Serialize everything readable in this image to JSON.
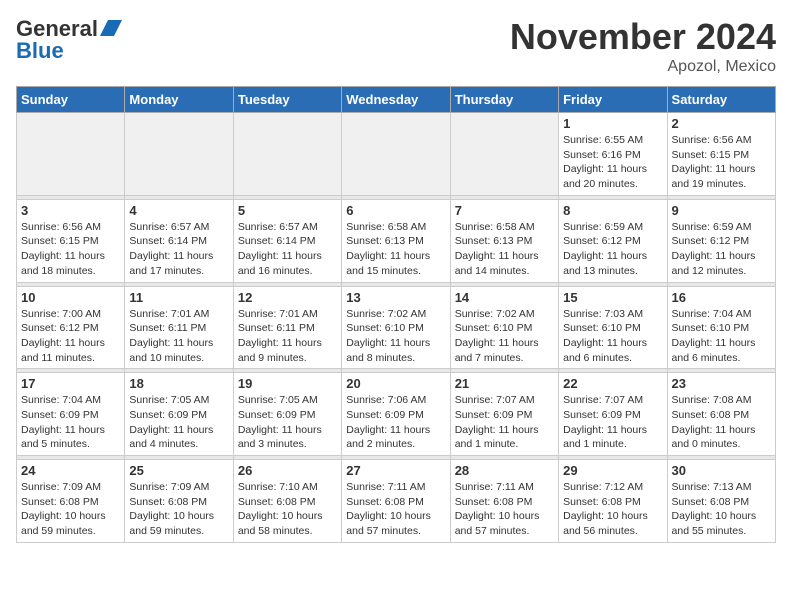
{
  "header": {
    "logo_general": "General",
    "logo_blue": "Blue",
    "month_title": "November 2024",
    "location": "Apozol, Mexico"
  },
  "weekdays": [
    "Sunday",
    "Monday",
    "Tuesday",
    "Wednesday",
    "Thursday",
    "Friday",
    "Saturday"
  ],
  "weeks": [
    [
      {
        "day": "",
        "info": ""
      },
      {
        "day": "",
        "info": ""
      },
      {
        "day": "",
        "info": ""
      },
      {
        "day": "",
        "info": ""
      },
      {
        "day": "",
        "info": ""
      },
      {
        "day": "1",
        "info": "Sunrise: 6:55 AM\nSunset: 6:16 PM\nDaylight: 11 hours and 20 minutes."
      },
      {
        "day": "2",
        "info": "Sunrise: 6:56 AM\nSunset: 6:15 PM\nDaylight: 11 hours and 19 minutes."
      }
    ],
    [
      {
        "day": "3",
        "info": "Sunrise: 6:56 AM\nSunset: 6:15 PM\nDaylight: 11 hours and 18 minutes."
      },
      {
        "day": "4",
        "info": "Sunrise: 6:57 AM\nSunset: 6:14 PM\nDaylight: 11 hours and 17 minutes."
      },
      {
        "day": "5",
        "info": "Sunrise: 6:57 AM\nSunset: 6:14 PM\nDaylight: 11 hours and 16 minutes."
      },
      {
        "day": "6",
        "info": "Sunrise: 6:58 AM\nSunset: 6:13 PM\nDaylight: 11 hours and 15 minutes."
      },
      {
        "day": "7",
        "info": "Sunrise: 6:58 AM\nSunset: 6:13 PM\nDaylight: 11 hours and 14 minutes."
      },
      {
        "day": "8",
        "info": "Sunrise: 6:59 AM\nSunset: 6:12 PM\nDaylight: 11 hours and 13 minutes."
      },
      {
        "day": "9",
        "info": "Sunrise: 6:59 AM\nSunset: 6:12 PM\nDaylight: 11 hours and 12 minutes."
      }
    ],
    [
      {
        "day": "10",
        "info": "Sunrise: 7:00 AM\nSunset: 6:12 PM\nDaylight: 11 hours and 11 minutes."
      },
      {
        "day": "11",
        "info": "Sunrise: 7:01 AM\nSunset: 6:11 PM\nDaylight: 11 hours and 10 minutes."
      },
      {
        "day": "12",
        "info": "Sunrise: 7:01 AM\nSunset: 6:11 PM\nDaylight: 11 hours and 9 minutes."
      },
      {
        "day": "13",
        "info": "Sunrise: 7:02 AM\nSunset: 6:10 PM\nDaylight: 11 hours and 8 minutes."
      },
      {
        "day": "14",
        "info": "Sunrise: 7:02 AM\nSunset: 6:10 PM\nDaylight: 11 hours and 7 minutes."
      },
      {
        "day": "15",
        "info": "Sunrise: 7:03 AM\nSunset: 6:10 PM\nDaylight: 11 hours and 6 minutes."
      },
      {
        "day": "16",
        "info": "Sunrise: 7:04 AM\nSunset: 6:10 PM\nDaylight: 11 hours and 6 minutes."
      }
    ],
    [
      {
        "day": "17",
        "info": "Sunrise: 7:04 AM\nSunset: 6:09 PM\nDaylight: 11 hours and 5 minutes."
      },
      {
        "day": "18",
        "info": "Sunrise: 7:05 AM\nSunset: 6:09 PM\nDaylight: 11 hours and 4 minutes."
      },
      {
        "day": "19",
        "info": "Sunrise: 7:05 AM\nSunset: 6:09 PM\nDaylight: 11 hours and 3 minutes."
      },
      {
        "day": "20",
        "info": "Sunrise: 7:06 AM\nSunset: 6:09 PM\nDaylight: 11 hours and 2 minutes."
      },
      {
        "day": "21",
        "info": "Sunrise: 7:07 AM\nSunset: 6:09 PM\nDaylight: 11 hours and 1 minute."
      },
      {
        "day": "22",
        "info": "Sunrise: 7:07 AM\nSunset: 6:09 PM\nDaylight: 11 hours and 1 minute."
      },
      {
        "day": "23",
        "info": "Sunrise: 7:08 AM\nSunset: 6:08 PM\nDaylight: 11 hours and 0 minutes."
      }
    ],
    [
      {
        "day": "24",
        "info": "Sunrise: 7:09 AM\nSunset: 6:08 PM\nDaylight: 10 hours and 59 minutes."
      },
      {
        "day": "25",
        "info": "Sunrise: 7:09 AM\nSunset: 6:08 PM\nDaylight: 10 hours and 59 minutes."
      },
      {
        "day": "26",
        "info": "Sunrise: 7:10 AM\nSunset: 6:08 PM\nDaylight: 10 hours and 58 minutes."
      },
      {
        "day": "27",
        "info": "Sunrise: 7:11 AM\nSunset: 6:08 PM\nDaylight: 10 hours and 57 minutes."
      },
      {
        "day": "28",
        "info": "Sunrise: 7:11 AM\nSunset: 6:08 PM\nDaylight: 10 hours and 57 minutes."
      },
      {
        "day": "29",
        "info": "Sunrise: 7:12 AM\nSunset: 6:08 PM\nDaylight: 10 hours and 56 minutes."
      },
      {
        "day": "30",
        "info": "Sunrise: 7:13 AM\nSunset: 6:08 PM\nDaylight: 10 hours and 55 minutes."
      }
    ]
  ]
}
